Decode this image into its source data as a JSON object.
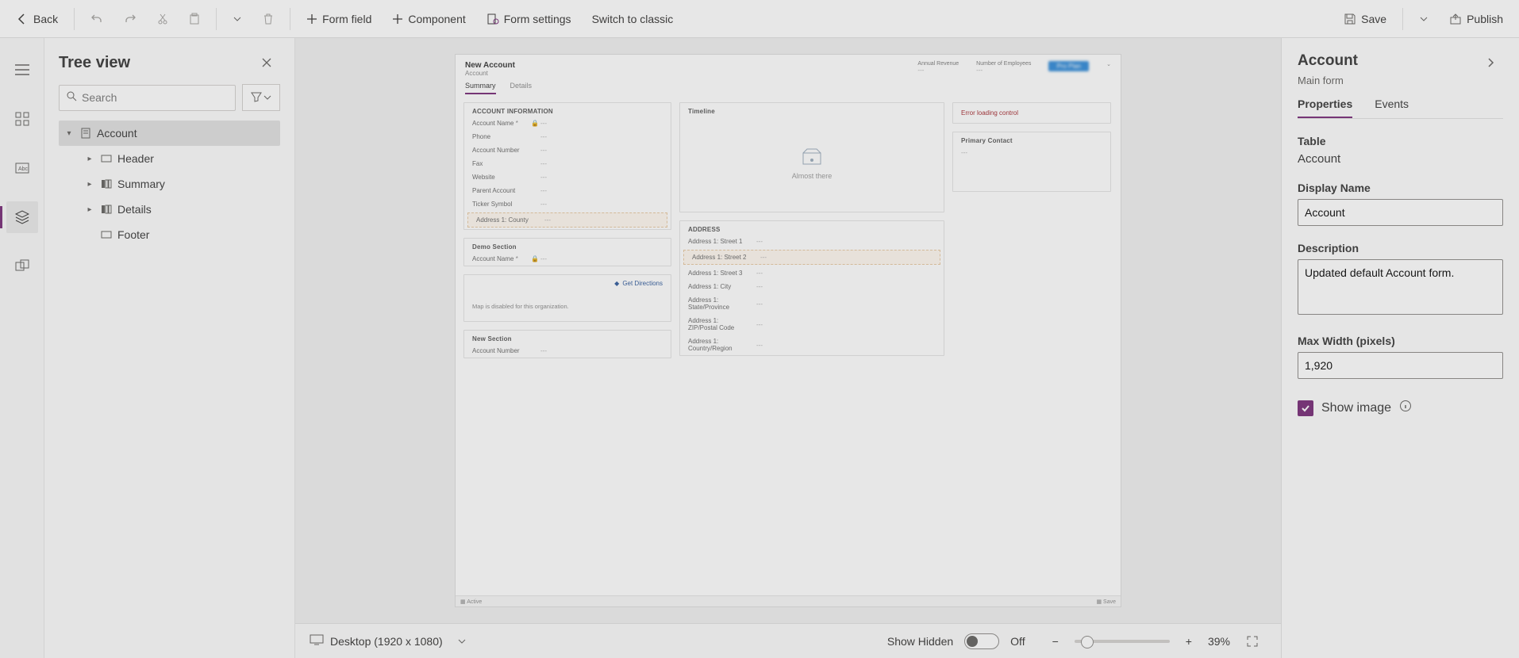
{
  "commandBar": {
    "back": "Back",
    "formField": "Form field",
    "component": "Component",
    "formSettings": "Form settings",
    "switchClassic": "Switch to classic",
    "save": "Save",
    "publish": "Publish"
  },
  "treePanel": {
    "title": "Tree view",
    "searchPlaceholder": "Search",
    "items": {
      "root": "Account",
      "header": "Header",
      "summary": "Summary",
      "details": "Details",
      "footer": "Footer"
    }
  },
  "canvas": {
    "header": {
      "title": "New Account",
      "subtitle": "Account",
      "metrics": {
        "annualRevenue": "Annual Revenue",
        "numEmployees": "Number of Employees"
      },
      "tag": "Pro Plan"
    },
    "tabs": {
      "summary": "Summary",
      "details": "Details"
    },
    "sections": {
      "accountInfo": {
        "title": "ACCOUNT INFORMATION",
        "fields": {
          "accountName": "Account Name",
          "phone": "Phone",
          "accountNumber": "Account Number",
          "fax": "Fax",
          "website": "Website",
          "parentAccount": "Parent Account",
          "tickerSymbol": "Ticker Symbol",
          "address1County": "Address 1: County"
        }
      },
      "demo": {
        "title": "Demo Section",
        "fields": {
          "accountName": "Account Name"
        }
      },
      "map": {
        "getDirections": "Get Directions",
        "note": "Map is disabled for this organization."
      },
      "newSection": {
        "title": "New Section",
        "fields": {
          "accountNumber": "Account Number"
        }
      },
      "timeline": {
        "title": "Timeline",
        "status": "Almost there"
      },
      "address": {
        "title": "ADDRESS",
        "fields": {
          "street1": "Address 1: Street 1",
          "street2": "Address 1: Street 2",
          "street3": "Address 1: Street 3",
          "city": "Address 1: City",
          "state": "Address 1: State/Province",
          "zip": "Address 1: ZIP/Postal Code",
          "country": "Address 1: Country/Region"
        }
      },
      "error": "Error loading control",
      "primaryContact": {
        "title": "Primary Contact"
      }
    },
    "footer": {
      "active": "Active",
      "save": "Save"
    },
    "dash": "---"
  },
  "statusBar": {
    "viewport": "Desktop (1920 x 1080)",
    "showHidden": "Show Hidden",
    "toggleState": "Off",
    "zoom": "39%"
  },
  "properties": {
    "heading": "Account",
    "subheading": "Main form",
    "tabs": {
      "properties": "Properties",
      "events": "Events"
    },
    "tableLabel": "Table",
    "tableValue": "Account",
    "displayNameLabel": "Display Name",
    "displayNameValue": "Account",
    "descriptionLabel": "Description",
    "descriptionValue": "Updated default Account form.",
    "maxWidthLabel": "Max Width (pixels)",
    "maxWidthValue": "1,920",
    "showImageLabel": "Show image"
  }
}
